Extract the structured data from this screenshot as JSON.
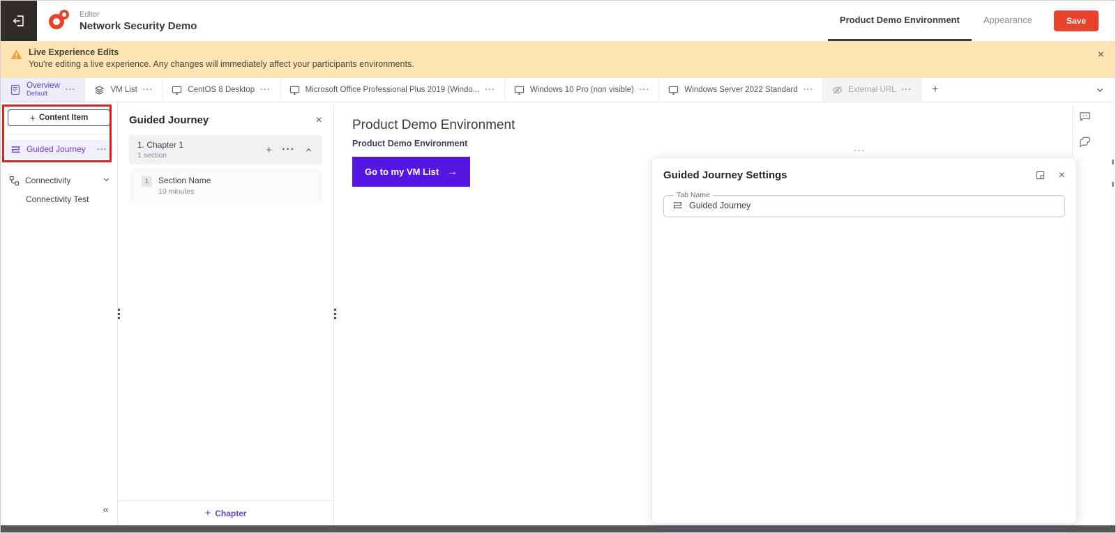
{
  "colors": {
    "accent_purple": "#6143C6",
    "cta_purple": "#5517E0",
    "brand_red": "#E8432C",
    "banner_bg": "#FCE4B5",
    "annotation_red": "#E01E1E"
  },
  "icons": {
    "more": "···",
    "close": "×",
    "collapse_left": "«",
    "plus": "+",
    "arrow_right": "→"
  },
  "header": {
    "app_label": "Editor",
    "title": "Network Security Demo",
    "tabs": [
      {
        "label": "Product Demo Environment",
        "active": true
      },
      {
        "label": "Appearance",
        "active": false
      }
    ],
    "save_label": "Save"
  },
  "banner": {
    "title": "Live Experience Edits",
    "message": "You're editing a live experience. Any changes will immediately affect your participants environments."
  },
  "tabbar": {
    "tabs": [
      {
        "label": "Overview",
        "sublabel": "Default",
        "icon": "overview-icon",
        "state": "active"
      },
      {
        "label": "VM List",
        "icon": "layers-icon",
        "state": "normal"
      },
      {
        "label": "CentOS 8 Desktop",
        "icon": "monitor-icon",
        "state": "normal"
      },
      {
        "label": "Microsoft Office Professional Plus 2019 (Windo...",
        "icon": "monitor-icon",
        "state": "normal"
      },
      {
        "label": "Windows 10 Pro (non visible)",
        "icon": "monitor-icon",
        "state": "normal"
      },
      {
        "label": "Windows Server 2022 Standard",
        "icon": "monitor-icon",
        "state": "normal"
      },
      {
        "label": "External URL",
        "icon": "eye-off-icon",
        "state": "disabled"
      }
    ]
  },
  "sidebar": {
    "add_button_label": "Content Item",
    "guided_journey_label": "Guided Journey",
    "connectivity_label": "Connectivity",
    "connectivity_test_label": "Connectivity Test"
  },
  "journey_panel": {
    "title": "Guided Journey",
    "chapter": {
      "name": "1. Chapter 1",
      "meta": "1 section"
    },
    "section": {
      "badge": "1",
      "name": "Section Name",
      "duration": "10 minutes"
    },
    "add_chapter_label": "Chapter"
  },
  "main": {
    "heading": "Product Demo Environment",
    "subheading": "Product Demo Environment",
    "cta_label": "Go to my VM List"
  },
  "settings_panel": {
    "title": "Guided Journey Settings",
    "field_label": "Tab Name",
    "field_value": "Guided Journey"
  }
}
